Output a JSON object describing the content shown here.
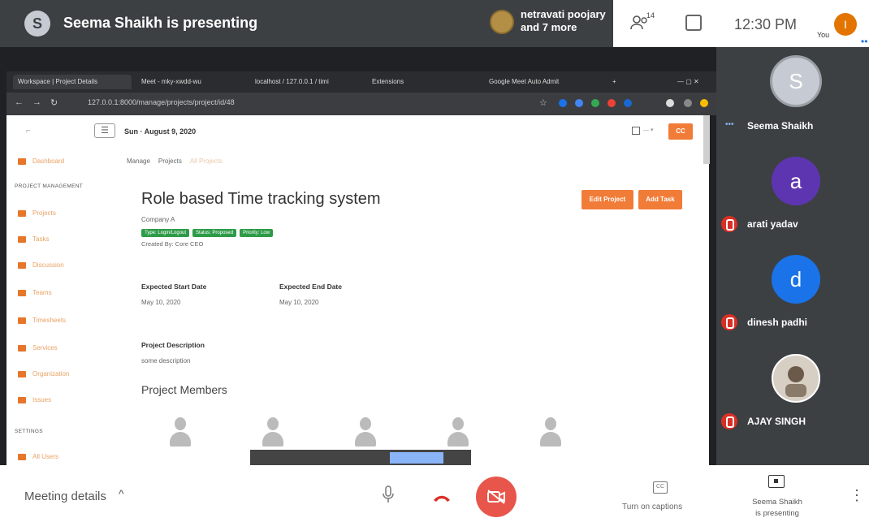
{
  "meet": {
    "presenter_initial": "S",
    "presenting_banner": "Seema Shaikh is presenting",
    "viewers_line1": "netravati poojary",
    "viewers_line2": "and 7 more",
    "people_count": "14",
    "time": "12:30 PM",
    "you_label": "You",
    "you_initial": "I"
  },
  "browser": {
    "tabs": [
      {
        "label": "Workspace | Project Details",
        "active": true
      },
      {
        "label": "Meet - mky-xwdd-wu",
        "active": false
      },
      {
        "label": "localhost / 127.0.0.1 / timi",
        "active": false
      },
      {
        "label": "Extensions",
        "active": false
      },
      {
        "label": "Google Meet Auto Admit",
        "active": false
      }
    ],
    "url": "127.0.0.1:8000/manage/projects/project/id/48"
  },
  "app": {
    "header": {
      "date": "Sun · August 9, 2020",
      "user_btn": "CC"
    },
    "sidebar": {
      "dashboard": "Dashboard",
      "section_project": "PROJECT MANAGEMENT",
      "items": [
        "Projects",
        "Tasks",
        "Discussion",
        "Teams",
        "Timesheets",
        "Services",
        "Organization",
        "Issues"
      ],
      "section_settings": "SETTINGS",
      "settings_items": [
        "All Users"
      ]
    },
    "breadcrumb": [
      "Manage",
      "Projects",
      "All Projects"
    ],
    "project": {
      "title": "Role based Time tracking system",
      "company": "Company A",
      "badges": [
        "Type: Login/Logout",
        "Status: Proposed",
        "Priority: Low"
      ],
      "created_by": "Created By: Core CEO",
      "edit_btn": "Edit Project",
      "add_task_btn": "Add Task",
      "start_label": "Expected Start Date",
      "start_value": "May 10, 2020",
      "end_label": "Expected End Date",
      "end_value": "May 10, 2020",
      "desc_label": "Project Description",
      "desc_value": "some description",
      "members_title": "Project Members"
    }
  },
  "participants": [
    {
      "initial": "S",
      "name": "Seema Shaikh",
      "color": "#c6cbd3",
      "muted": false
    },
    {
      "initial": "a",
      "name": "arati yadav",
      "color": "#5e35b1",
      "muted": true
    },
    {
      "initial": "d",
      "name": "dinesh padhi",
      "color": "#1a73e8",
      "muted": true
    },
    {
      "initial": "",
      "name": "AJAY SINGH",
      "color": "#d8cfc4",
      "muted": true
    }
  ],
  "bottom": {
    "meeting_details": "Meeting details",
    "captions": "Turn on captions",
    "cc_icon": "CC",
    "presenting_line1": "Seema Shaikh",
    "presenting_line2": "is presenting"
  }
}
